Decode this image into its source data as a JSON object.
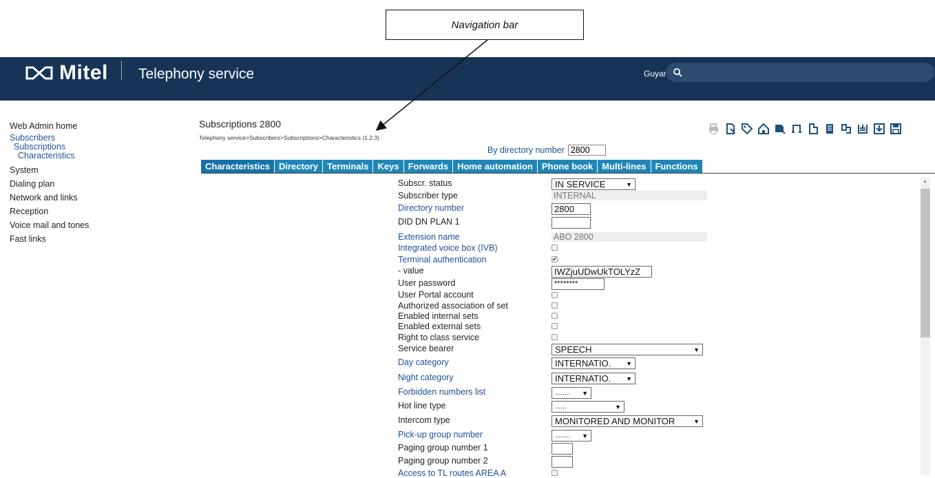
{
  "callout": {
    "label": "Navigation bar"
  },
  "header": {
    "logo_text": "Mitel",
    "title": "Telephony service",
    "site": "Guyancourt",
    "search_placeholder": ""
  },
  "sidebar": {
    "items": [
      "Web Admin home",
      "Subscribers",
      "Subscriptions",
      "Characteristics",
      "System",
      "Dialing plan",
      "Network and links",
      "Reception",
      "Voice mail and tones",
      "Fast links"
    ]
  },
  "main": {
    "title": "Subscriptions 2800",
    "breadcrumb": "Telephony service>Subscribers>Subscriptions>Characteristics (1.2.3)",
    "dir_label": "By directory number",
    "dir_value": "2800",
    "tabs": [
      "Characteristics",
      "Directory",
      "Terminals",
      "Keys",
      "Forwards",
      "Home automation",
      "Phone book",
      "Multi-lines",
      "Functions"
    ]
  },
  "toolbar_icons": [
    "printer-icon",
    "export-icon",
    "tag-icon",
    "home-icon",
    "import-icon",
    "transfer-icon",
    "document-icon",
    "list-icon",
    "copy-icon",
    "archive-icon",
    "download-icon",
    "save-icon"
  ],
  "form": {
    "fields": [
      {
        "label": "Subscr. status",
        "value": "IN SERVICE"
      },
      {
        "label": "Subscriber type",
        "value": "INTERNAL"
      },
      {
        "label": "Directory number",
        "value": "2800"
      },
      {
        "label": "DID DN PLAN 1",
        "value": ""
      },
      {
        "label": "Extension name",
        "value": "ABO 2800"
      },
      {
        "label": "Integrated voice box (IVB)",
        "value": ""
      },
      {
        "label": "Terminal authentication",
        "value": "✔"
      },
      {
        "label": "- value",
        "value": "IWZjuUDwUkTOLYzZ"
      },
      {
        "label": "User password",
        "value": "********"
      },
      {
        "label": "User Portal account",
        "value": ""
      },
      {
        "label": "Authorized association of set",
        "value": ""
      },
      {
        "label": "Enabled internal sets",
        "value": ""
      },
      {
        "label": "Enabled external sets",
        "value": ""
      },
      {
        "label": "Right to class service",
        "value": ""
      },
      {
        "label": "Service bearer",
        "value": "SPEECH"
      },
      {
        "label": "Day category",
        "value": "INTERNATIO."
      },
      {
        "label": "Night category",
        "value": "INTERNATIO."
      },
      {
        "label": "Forbidden numbers list",
        "value": "........"
      },
      {
        "label": "Hot line type",
        "value": "......"
      },
      {
        "label": "Intercom type",
        "value": "MONITORED AND MONITOR"
      },
      {
        "label": "Pick-up group number",
        "value": "........"
      },
      {
        "label": "Paging group number 1",
        "value": ""
      },
      {
        "label": "Paging group number 2",
        "value": ""
      },
      {
        "label": "Access to TL routes AREA A",
        "value": ""
      }
    ]
  },
  "colors": {
    "header_bg": "#173457",
    "tab_bg": "#1f86b8",
    "link": "#1f4f99"
  }
}
